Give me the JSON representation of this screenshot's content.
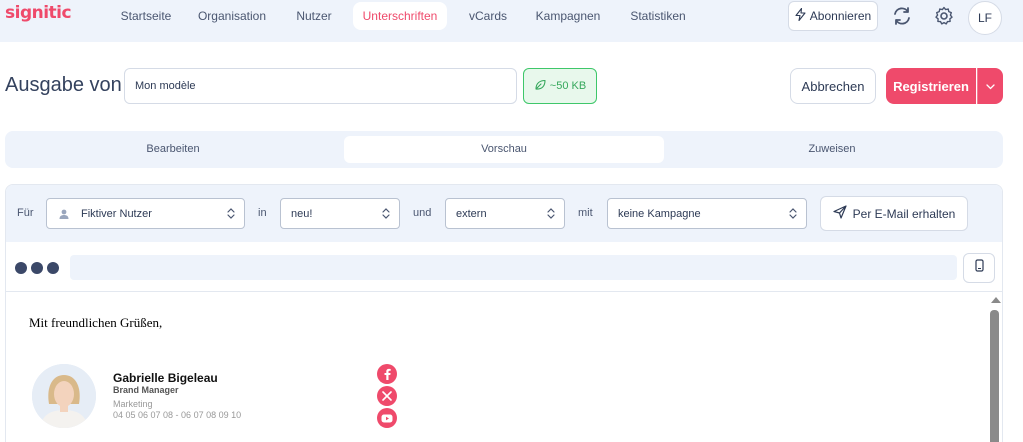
{
  "app": {
    "logo": "signitic"
  },
  "nav": {
    "items": [
      {
        "label": "Startseite"
      },
      {
        "label": "Organisation"
      },
      {
        "label": "Nutzer"
      },
      {
        "label": "Unterschriften"
      },
      {
        "label": "vCards"
      },
      {
        "label": "Kampagnen"
      },
      {
        "label": "Statistiken"
      }
    ],
    "active": "Unterschriften",
    "subscribe_label": "Abonnieren",
    "avatar_initials": "LF"
  },
  "editor": {
    "title": "Ausgabe von",
    "name_value": "Mon modèle",
    "size_badge": "~50 KB",
    "cancel_label": "Abbrechen",
    "register_label": "Registrieren"
  },
  "tabs": [
    {
      "label": "Bearbeiten"
    },
    {
      "label": "Vorschau"
    },
    {
      "label": "Zuweisen"
    }
  ],
  "active_tab": "Vorschau",
  "filters": {
    "for_label": "Für",
    "user_value": "Fiktiver Nutzer",
    "in_label": "in",
    "mode_value": "neu!",
    "and_label": "und",
    "scope_value": "extern",
    "with_label": "mit",
    "campaign_value": "keine Kampagne",
    "email_button": "Per E-Mail erhalten"
  },
  "preview": {
    "greeting": "Mit freundlichen Grüßen,",
    "name": "Gabrielle Bigeleau",
    "role": "Brand Manager",
    "department": "Marketing",
    "phone": "04 05 06 07 08 - 06 07 08 09 10",
    "socials": [
      "facebook-icon",
      "x-icon",
      "youtube-icon"
    ]
  },
  "colors": {
    "accent": "#ef4a6b",
    "nav_bg": "#eef3fb",
    "success": "#36a85c",
    "text": "#2d3a55"
  }
}
